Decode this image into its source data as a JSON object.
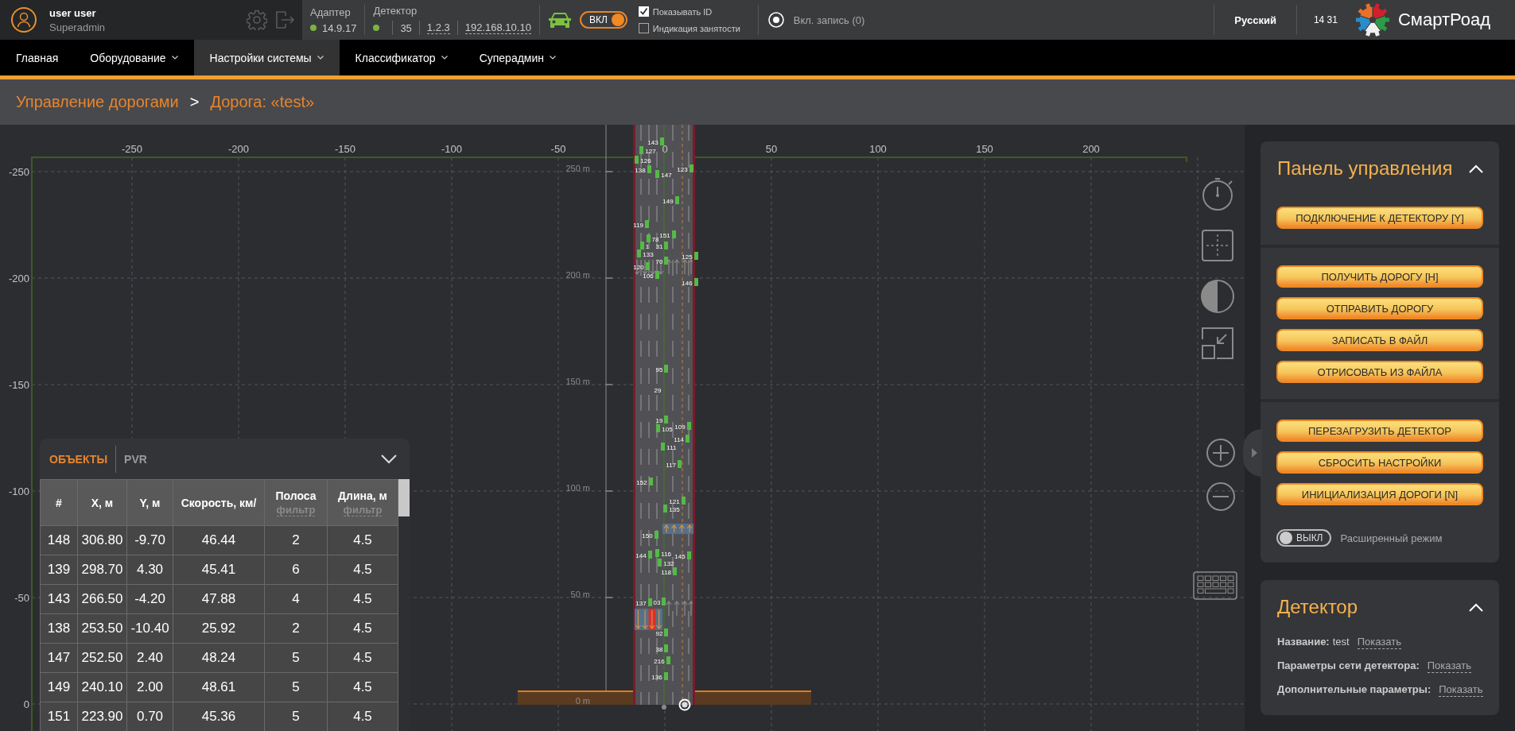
{
  "top_bar": {
    "user": {
      "name": "user user",
      "role": "Superadmin"
    },
    "adapter": {
      "title": "Адаптер",
      "color": "#7cb342",
      "version": "14.9.17"
    },
    "detector": {
      "title": "Детектор",
      "color": "#7cb342",
      "fields": [
        {
          "text": "35",
          "link": false
        },
        {
          "text": "1.2.3",
          "link": true
        },
        {
          "text": "192.168.10.10",
          "link": true
        }
      ]
    },
    "power_toggle": {
      "label": "ВКЛ",
      "on": true
    },
    "checkboxes": [
      {
        "label": "Показывать ID",
        "checked": true
      },
      {
        "label": "Индикация занятости",
        "checked": false
      }
    ],
    "record": {
      "label": "Вкл. запись (0)"
    },
    "language": "Русский",
    "time": "14 31",
    "brand": "СмартРоад"
  },
  "nav": [
    {
      "label": "Главная",
      "has_menu": false,
      "selected": false
    },
    {
      "label": "Оборудование",
      "has_menu": true,
      "selected": false
    },
    {
      "label": "Настройки системы",
      "has_menu": true,
      "selected": true
    },
    {
      "label": "Классификатор",
      "has_menu": true,
      "selected": false
    },
    {
      "label": "Суперадмин",
      "has_menu": true,
      "selected": false
    }
  ],
  "breadcrumb": {
    "items": [
      "Управление дорогами",
      "Дорога: «test»"
    ],
    "separator": ">"
  },
  "road_view": {
    "x_axis_labels": [
      "-250",
      "-200",
      "-150",
      "-100",
      "-50",
      "0",
      "50",
      "100",
      "150",
      "200"
    ],
    "y_axis_labels": [
      "-250",
      "-200",
      "-150",
      "-100",
      "-50",
      "0"
    ],
    "distance_labels": [
      "250 m",
      "200 m",
      "150 m",
      "100 m",
      "50 m",
      "0 m"
    ],
    "detection_zones": [
      {
        "kind": "up",
        "lanes": [
          {
            "occupied": false
          },
          {
            "occupied": false
          },
          {
            "occupied": false
          },
          {
            "occupied": false
          }
        ]
      },
      {
        "kind": "down",
        "lanes": [
          {
            "occupied": false
          },
          {
            "occupied": false
          },
          {
            "occupied": true
          },
          {
            "occupied": false
          }
        ]
      }
    ],
    "vehicles": [
      {
        "label": "143",
        "marker": true
      },
      {
        "label": "127",
        "marker": true
      },
      {
        "label": "126",
        "marker": true
      },
      {
        "label": "138",
        "marker": true
      },
      {
        "label": "147",
        "marker": true
      },
      {
        "label": "123",
        "marker": true
      },
      {
        "label": "149",
        "marker": true
      },
      {
        "label": "119",
        "marker": true
      },
      {
        "label": "151",
        "marker": true
      },
      {
        "label": "78",
        "marker": true
      },
      {
        "label": "1",
        "marker": true
      },
      {
        "label": "31",
        "marker": true
      },
      {
        "label": "133",
        "marker": true
      },
      {
        "label": "125",
        "marker": true
      },
      {
        "label": "70",
        "marker": true
      },
      {
        "label": "120",
        "marker": true
      },
      {
        "label": "106",
        "marker": true
      },
      {
        "label": "146",
        "marker": true
      },
      {
        "label": "95",
        "marker": true
      },
      {
        "label": "29",
        "marker": false
      },
      {
        "label": "19",
        "marker": true
      },
      {
        "label": "105",
        "marker": true
      },
      {
        "label": "109",
        "marker": true
      },
      {
        "label": "114",
        "marker": true
      },
      {
        "label": "111",
        "marker": true
      },
      {
        "label": "117",
        "marker": true
      },
      {
        "label": "152",
        "marker": true
      },
      {
        "label": "121",
        "marker": true
      },
      {
        "label": "135",
        "marker": true
      },
      {
        "label": "150",
        "marker": true
      },
      {
        "label": "144",
        "marker": true
      },
      {
        "label": "116",
        "marker": true
      },
      {
        "label": "145",
        "marker": true
      },
      {
        "label": "132",
        "marker": true
      },
      {
        "label": "118",
        "marker": true
      },
      {
        "label": "03",
        "marker": true
      },
      {
        "label": "137",
        "marker": true
      },
      {
        "label": "92",
        "marker": true
      },
      {
        "label": "38",
        "marker": true
      },
      {
        "label": "216",
        "marker": true
      },
      {
        "label": "136",
        "marker": true
      }
    ]
  },
  "objects_panel": {
    "tabs": [
      {
        "label": "ОБЪЕКТЫ",
        "selected": true
      },
      {
        "label": "PVR",
        "selected": false
      }
    ],
    "columns": [
      {
        "label": "#"
      },
      {
        "label": "X, м"
      },
      {
        "label": "Y, м"
      },
      {
        "label": "Скорость, км/"
      },
      {
        "label": "Полоса",
        "filter": "фильтр"
      },
      {
        "label": "Длина, м",
        "filter": "фильтр"
      }
    ],
    "rows": [
      [
        "148",
        "306.80",
        "-9.70",
        "46.44",
        "2",
        "4.5"
      ],
      [
        "139",
        "298.70",
        "4.30",
        "45.41",
        "6",
        "4.5"
      ],
      [
        "143",
        "266.50",
        "-4.20",
        "47.88",
        "4",
        "4.5"
      ],
      [
        "138",
        "253.50",
        "-10.40",
        "25.92",
        "2",
        "4.5"
      ],
      [
        "147",
        "252.50",
        "2.40",
        "48.24",
        "5",
        "4.5"
      ],
      [
        "149",
        "240.10",
        "2.00",
        "48.61",
        "5",
        "4.5"
      ],
      [
        "151",
        "223.90",
        "0.70",
        "45.36",
        "5",
        "4.5"
      ]
    ]
  },
  "control_panel": {
    "title": "Панель управления",
    "groups": [
      [
        "ПОДКЛЮЧЕНИЕ К ДЕТЕКТОРУ [Y]"
      ],
      [
        "ПОЛУЧИТЬ ДОРОГУ [H]",
        "ОТПРАВИТЬ ДОРОГУ",
        "ЗАПИСАТЬ В ФАЙЛ",
        "ОТРИСОВАТЬ ИЗ ФАЙЛА"
      ],
      [
        "ПЕРЕЗАГРУЗИТЬ ДЕТЕКТОР",
        "СБРОСИТЬ НАСТРОЙКИ",
        "ИНИЦИАЛИЗАЦИЯ ДОРОГИ [N]"
      ]
    ],
    "advanced_toggle": {
      "label": "ВЫКЛ",
      "on": false,
      "caption": "Расширенный режим"
    }
  },
  "detector_panel": {
    "title": "Детектор",
    "rows": [
      {
        "label": "Название:",
        "value": "test",
        "link": "Показать"
      },
      {
        "label": "Параметры сети детектора:",
        "link": "Показать"
      },
      {
        "label": "Дополнительные параметры:",
        "link": "Показать"
      }
    ]
  }
}
